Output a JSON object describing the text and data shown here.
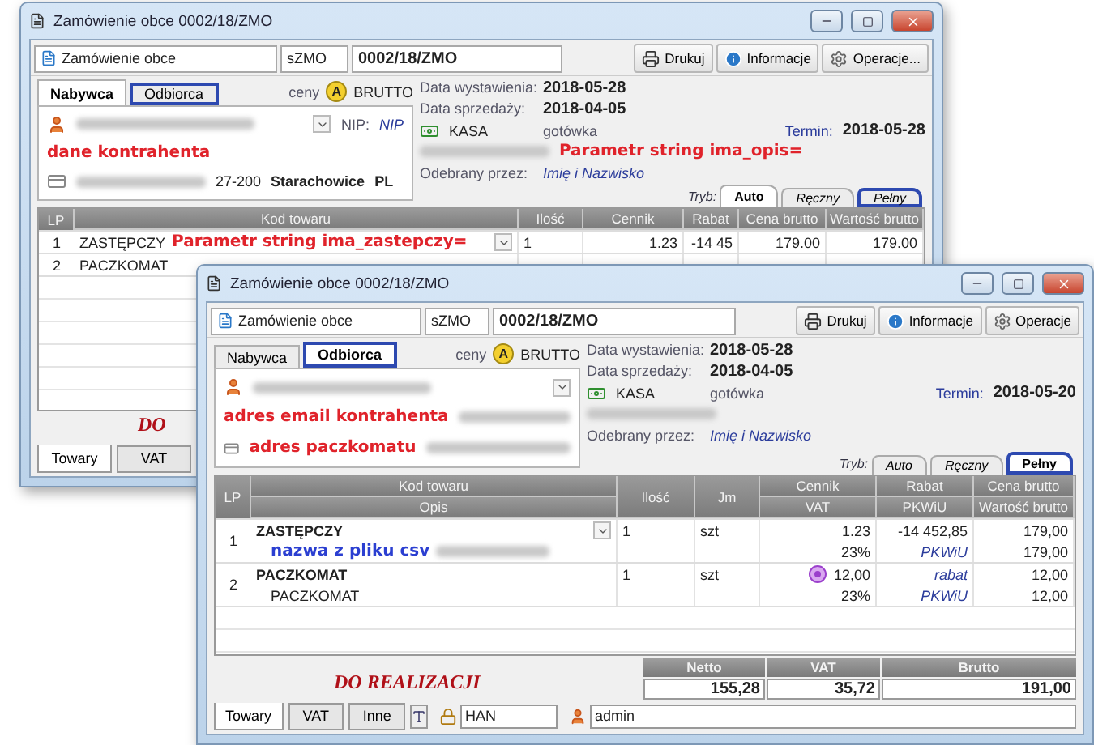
{
  "windows": [
    {
      "title": "Zamówienie obce 0002/18/ZMO",
      "doc_type": "Zamówienie obce",
      "series": "sZMO",
      "number": "0002/18/ZMO",
      "toolbar": [
        {
          "kind": "print",
          "label": "Drukuj"
        },
        {
          "kind": "info",
          "label": "Informacje"
        },
        {
          "kind": "gear",
          "label": "Operacje..."
        }
      ],
      "party_tabs": [
        {
          "label": "Nabywca",
          "selected": true,
          "focused": false
        },
        {
          "label": "Odbiorca",
          "selected": false,
          "focused": true
        }
      ],
      "prices_label": "ceny",
      "price_badge": "A",
      "price_mode": "BRUTTO",
      "party_lines": [
        [
          {
            "kind": "person"
          },
          {
            "kind": "blur"
          },
          {
            "kind": "dropdown"
          },
          {
            "kind": "label",
            "text": "NIP:"
          },
          {
            "kind": "link",
            "text": "NIP"
          }
        ],
        [
          {
            "kind": "note",
            "text": "dane kontrahenta"
          }
        ],
        [
          {
            "kind": "card"
          },
          {
            "kind": "blur"
          },
          {
            "kind": "text",
            "text": "27-200"
          },
          {
            "kind": "bold",
            "text": "Starachowice"
          },
          {
            "kind": "bold",
            "text": "PL"
          }
        ]
      ],
      "dates": [
        {
          "label": "Data wystawienia:",
          "value": "2018-05-28"
        },
        {
          "label": "Data sprzedaży:",
          "value": "2018-04-05"
        }
      ],
      "payment": {
        "method": "KASA",
        "type": "gotówka",
        "due_label": "Termin:",
        "due": "2018-05-28"
      },
      "extra_line": [
        {
          "kind": "blur"
        },
        {
          "kind": "note",
          "text": "Parametr string ima_opis="
        }
      ],
      "receiver": {
        "label": "Odebrany przez:",
        "value": "Imię i Nazwisko"
      },
      "mode_label": "Tryb:",
      "modes": [
        {
          "label": "Auto",
          "selected": true,
          "focused": false
        },
        {
          "label": "Ręczny",
          "selected": false,
          "focused": false
        },
        {
          "label": "Pełny",
          "selected": false,
          "focused": true
        }
      ],
      "table": {
        "lp_header": "LP",
        "columns": [
          {
            "label": "Kod towaru"
          },
          {
            "label": "Ilość"
          },
          {
            "label": "Cennik"
          },
          {
            "label": "Rabat"
          },
          {
            "label": "Cena brutto"
          },
          {
            "label": "Wartość brutto"
          }
        ],
        "rows": [
          {
            "lp": "1",
            "lines": [
              {
                "kod_towaru": [
                  {
                    "kind": "text",
                    "text": "ZASTĘPCZY"
                  },
                  {
                    "kind": "note",
                    "text": "Parametr string ima_zastepczy="
                  },
                  {
                    "kind": "dropdown"
                  }
                ],
                "ilosc": [
                  {
                    "kind": "text",
                    "text": "1"
                  }
                ],
                "cennik": [
                  {
                    "kind": "text",
                    "text": "1.23"
                  }
                ],
                "rabat": [
                  {
                    "kind": "text",
                    "text": "-14 45"
                  }
                ],
                "cena_brutto": [
                  {
                    "kind": "text",
                    "text": "179.00"
                  }
                ],
                "wartosc_brutto": [
                  {
                    "kind": "text",
                    "text": "179.00"
                  }
                ]
              }
            ]
          },
          {
            "lp": "2",
            "lines": [
              {
                "kod_towaru": [
                  {
                    "kind": "text",
                    "text": "PACZKOMAT"
                  }
                ]
              }
            ]
          }
        ]
      },
      "status": "DO",
      "bottom_tabs": [
        {
          "label": "Towary",
          "selected": true
        },
        {
          "label": "VAT",
          "selected": false
        }
      ]
    },
    {
      "title": "Zamówienie obce 0002/18/ZMO",
      "doc_type": "Zamówienie obce",
      "series": "sZMO",
      "number": "0002/18/ZMO",
      "toolbar": [
        {
          "kind": "print",
          "label": "Drukuj"
        },
        {
          "kind": "info",
          "label": "Informacje"
        },
        {
          "kind": "gear",
          "label": "Operacje"
        }
      ],
      "party_tabs": [
        {
          "label": "Nabywca",
          "selected": false,
          "focused": false
        },
        {
          "label": "Odbiorca",
          "selected": true,
          "focused": true
        }
      ],
      "prices_label": "ceny",
      "price_badge": "A",
      "price_mode": "BRUTTO",
      "party_lines": [
        [
          {
            "kind": "person"
          },
          {
            "kind": "blur"
          },
          {
            "kind": "dropdown"
          }
        ],
        [
          {
            "kind": "note",
            "text": "adres email kontrahenta"
          },
          {
            "kind": "blur"
          }
        ],
        [
          {
            "kind": "card"
          },
          {
            "kind": "note",
            "text": "adres paczkomatu"
          },
          {
            "kind": "blur"
          }
        ]
      ],
      "dates": [
        {
          "label": "Data wystawienia:",
          "value": "2018-05-28"
        },
        {
          "label": "Data sprzedaży:",
          "value": "2018-04-05"
        }
      ],
      "payment": {
        "method": "KASA",
        "type": "gotówka",
        "due_label": "Termin:",
        "due": "2018-05-20"
      },
      "extra_line": [
        {
          "kind": "blur"
        }
      ],
      "receiver": {
        "label": "Odebrany przez:",
        "value": "Imię i Nazwisko"
      },
      "mode_label": "Tryb:",
      "modes": [
        {
          "label": "Auto",
          "selected": false,
          "focused": false
        },
        {
          "label": "Ręczny",
          "selected": false,
          "focused": false
        },
        {
          "label": "Pełny",
          "selected": true,
          "focused": true
        }
      ],
      "table": {
        "lp_header": "LP",
        "columns": [
          {
            "label": "Kod towaru",
            "sub": "Opis"
          },
          {
            "label": "Ilość"
          },
          {
            "label": "Jm"
          },
          {
            "label": "Cennik",
            "sub": "VAT"
          },
          {
            "label": "Rabat",
            "sub": "PKWiU"
          },
          {
            "label": "Cena brutto",
            "sub": "Wartość brutto"
          }
        ],
        "rows": [
          {
            "lp": "1",
            "lines": [
              {
                "kod_towaru": [
                  {
                    "kind": "bold",
                    "text": "ZASTĘPCZY"
                  },
                  {
                    "kind": "dropdown"
                  }
                ],
                "ilosc": [
                  {
                    "kind": "text",
                    "text": "1"
                  }
                ],
                "jm": [
                  {
                    "kind": "text",
                    "text": "szt"
                  }
                ],
                "cennik": [
                  {
                    "kind": "text",
                    "text": "1.23"
                  }
                ],
                "rabat": [
                  {
                    "kind": "text",
                    "text": "-14 452,85"
                  }
                ],
                "cena_brutto": [
                  {
                    "kind": "text",
                    "text": "179,00"
                  }
                ]
              },
              {
                "opis": [
                  {
                    "kind": "note_blue",
                    "text": "nazwa z pliku csv"
                  },
                  {
                    "kind": "blur"
                  }
                ],
                "vat": [
                  {
                    "kind": "text",
                    "text": "23%"
                  }
                ],
                "pkwiu": [
                  {
                    "kind": "link",
                    "text": "PKWiU"
                  }
                ],
                "wartosc_brutto": [
                  {
                    "kind": "text",
                    "text": "179,00"
                  }
                ]
              }
            ]
          },
          {
            "lp": "2",
            "lines": [
              {
                "kod_towaru": [
                  {
                    "kind": "bold",
                    "text": "PACZKOMAT"
                  }
                ],
                "ilosc": [
                  {
                    "kind": "text",
                    "text": "1"
                  }
                ],
                "jm": [
                  {
                    "kind": "text",
                    "text": "szt"
                  }
                ],
                "cennik": [
                  {
                    "kind": "vat_icon"
                  },
                  {
                    "kind": "text",
                    "text": "12,00"
                  }
                ],
                "rabat": [
                  {
                    "kind": "link",
                    "text": "rabat"
                  }
                ],
                "cena_brutto": [
                  {
                    "kind": "text",
                    "text": "12,00"
                  }
                ]
              },
              {
                "opis": [
                  {
                    "kind": "text",
                    "text": "PACZKOMAT"
                  }
                ],
                "vat": [
                  {
                    "kind": "text",
                    "text": "23%"
                  }
                ],
                "pkwiu": [
                  {
                    "kind": "link",
                    "text": "PKWiU"
                  }
                ],
                "wartosc_brutto": [
                  {
                    "kind": "text",
                    "text": "12,00"
                  }
                ]
              }
            ]
          }
        ]
      },
      "status": "DO REALIZACJI",
      "totals": [
        {
          "label": "Netto",
          "value": "155,28"
        },
        {
          "label": "VAT",
          "value": "35,72"
        },
        {
          "label": "Brutto",
          "value": "191,00"
        }
      ],
      "bottom_tabs": [
        {
          "label": "Towary",
          "selected": true
        },
        {
          "label": "VAT",
          "selected": false
        },
        {
          "label": "Inne",
          "selected": false
        }
      ],
      "status_fields": [
        {
          "kind": "lock",
          "text": "HAN"
        },
        {
          "kind": "user",
          "text": "admin"
        }
      ]
    }
  ]
}
